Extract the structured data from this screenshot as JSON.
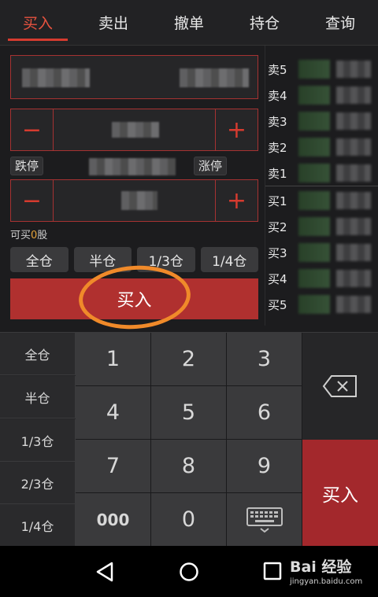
{
  "tabs": [
    {
      "label": "买入",
      "active": true
    },
    {
      "label": "卖出",
      "active": false
    },
    {
      "label": "撤单",
      "active": false
    },
    {
      "label": "持仓",
      "active": false
    },
    {
      "label": "查询",
      "active": false
    }
  ],
  "price": {
    "minus": "−",
    "plus": "+"
  },
  "limits": {
    "down": "跌停",
    "up": "涨停"
  },
  "quantity": {
    "minus": "−",
    "plus": "+"
  },
  "can_buy": {
    "prefix": "可买",
    "value": "0",
    "suffix": "股"
  },
  "qty_options": [
    "全仓",
    "半仓",
    "1/3仓",
    "1/4仓"
  ],
  "buy_button": "买入",
  "order_book": {
    "labels": [
      "卖5",
      "卖4",
      "卖3",
      "卖2",
      "卖1",
      "买1",
      "买2",
      "买3",
      "买4",
      "买5"
    ]
  },
  "keypad": {
    "side": [
      "全仓",
      "半仓",
      "1/3仓",
      "2/3仓",
      "1/4仓"
    ],
    "numbers": [
      "1",
      "2",
      "3",
      "4",
      "5",
      "6",
      "7",
      "8",
      "9",
      "000",
      "0"
    ],
    "buy": "买入"
  },
  "watermark": {
    "brand": "Bai 经验",
    "url": "jingyan.baidu.com"
  },
  "colors": {
    "accent": "#d63b2f",
    "buy": "#b0302f",
    "annotation": "#f08a2a"
  }
}
